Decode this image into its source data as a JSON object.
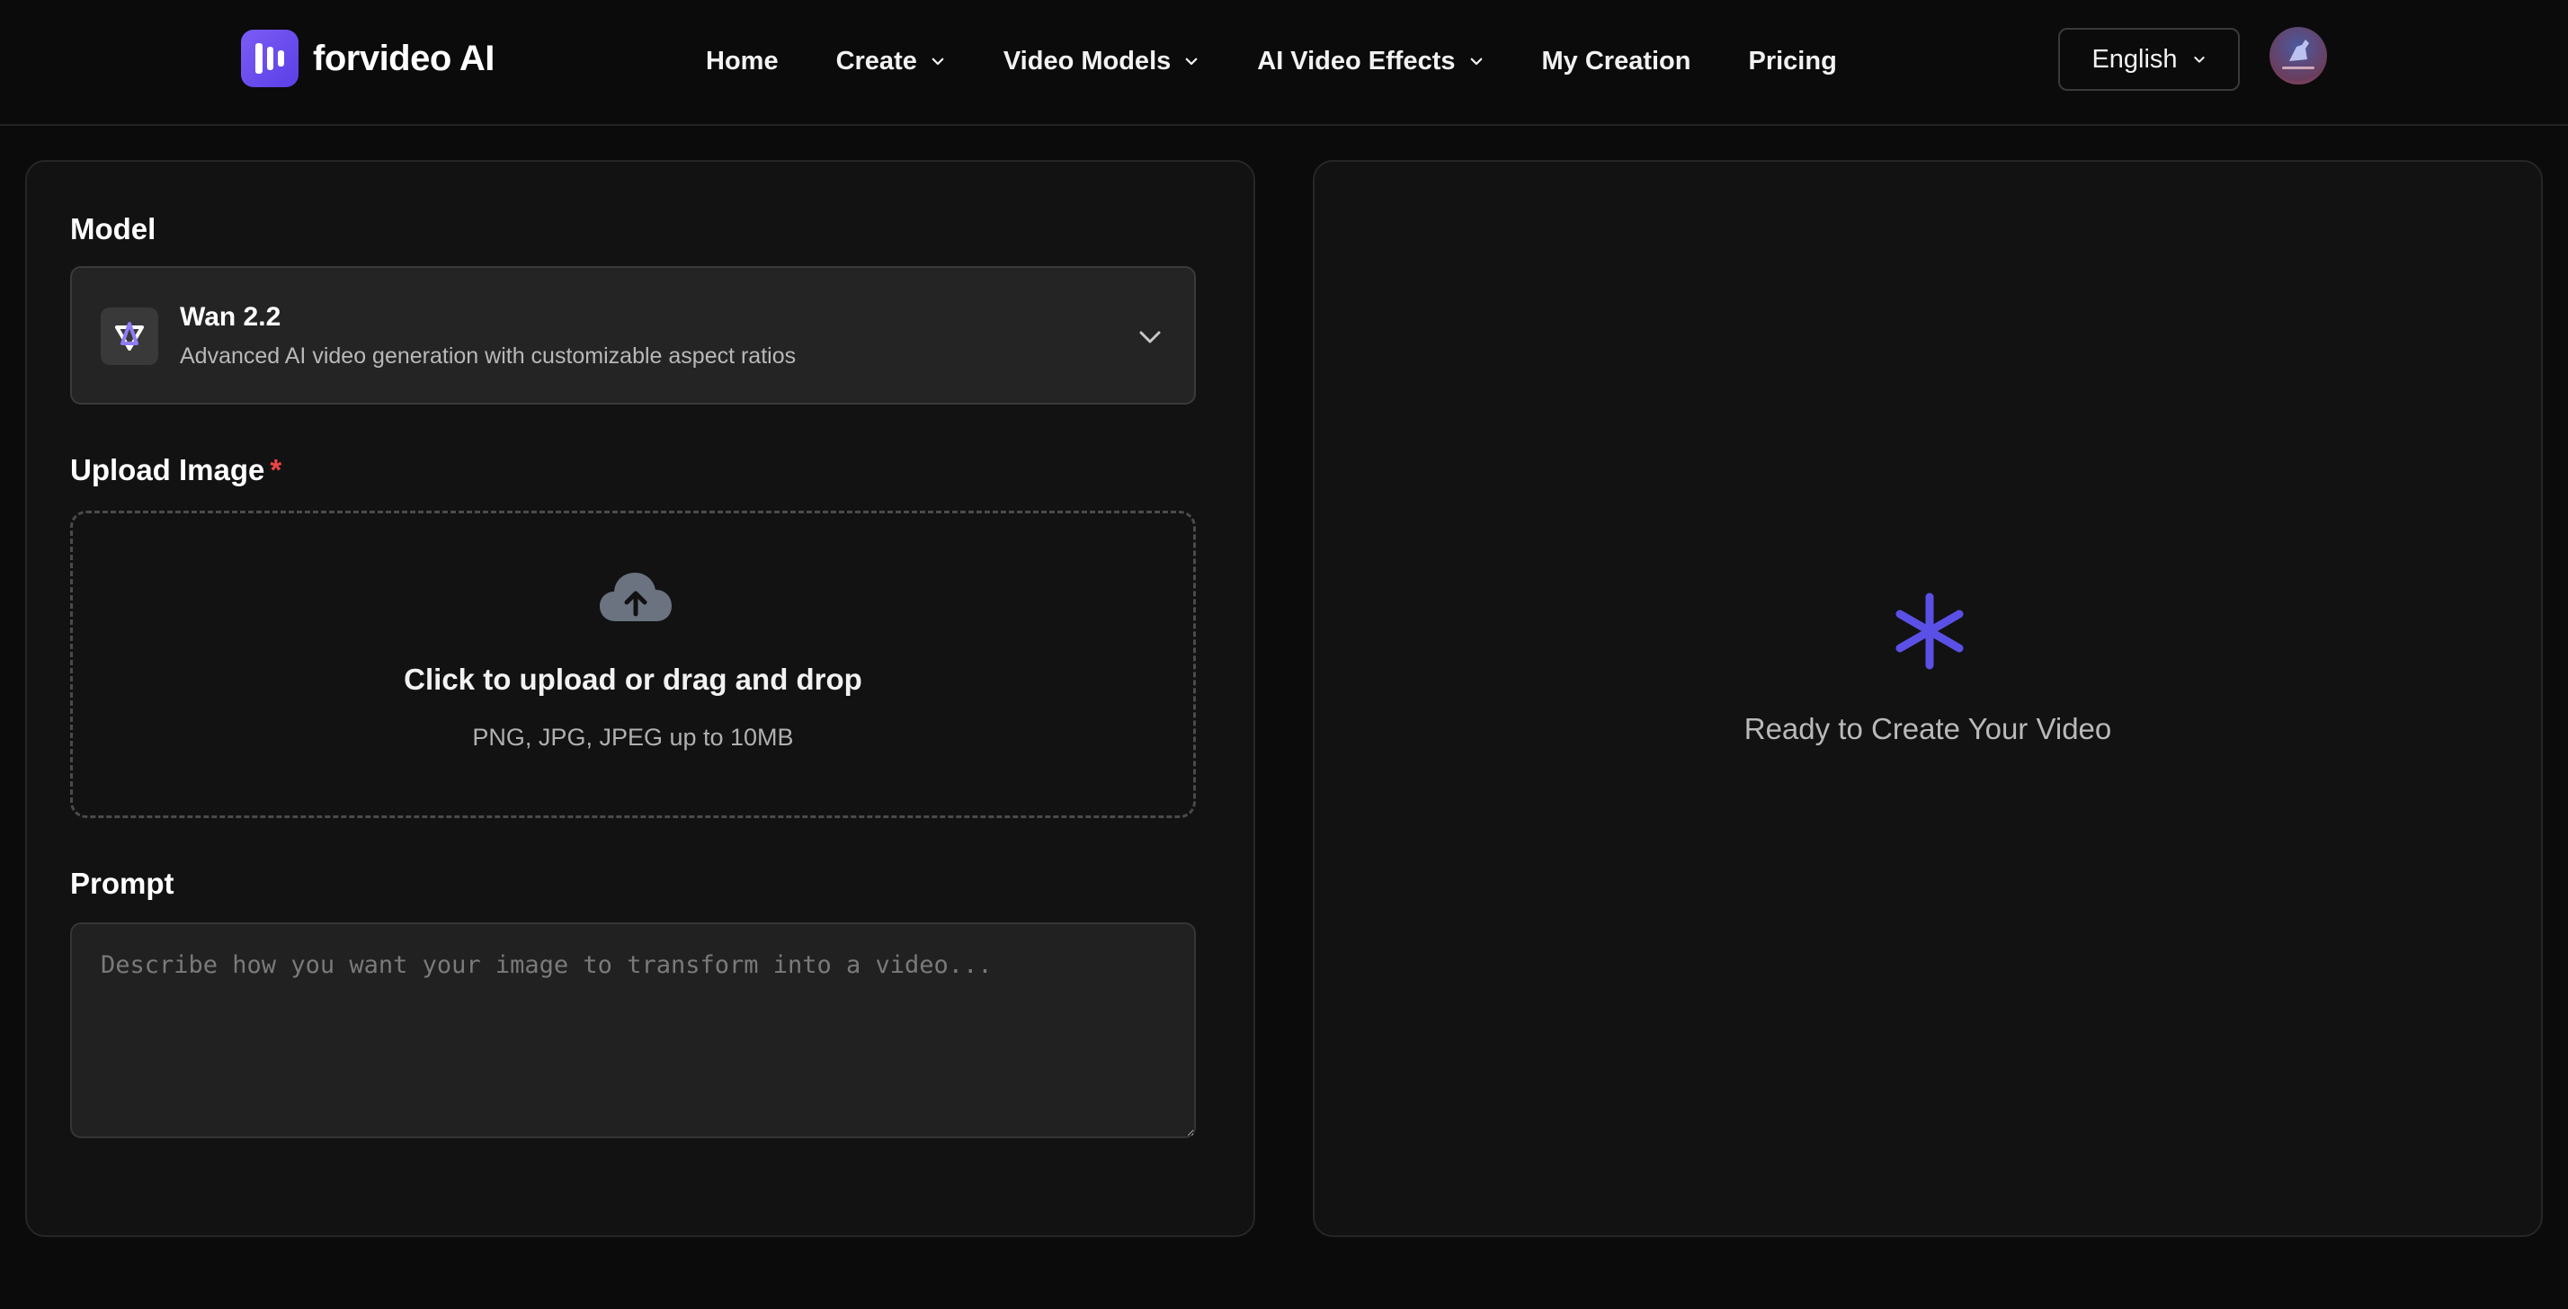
{
  "brand": {
    "name": "forvideo AI",
    "accent": "#6d4ff0"
  },
  "nav": [
    {
      "label": "Home",
      "has_dropdown": false
    },
    {
      "label": "Create",
      "has_dropdown": true
    },
    {
      "label": "Video Models",
      "has_dropdown": true
    },
    {
      "label": "AI Video Effects",
      "has_dropdown": true
    },
    {
      "label": "My Creation",
      "has_dropdown": false
    },
    {
      "label": "Pricing",
      "has_dropdown": false
    }
  ],
  "language": {
    "selected": "English"
  },
  "form": {
    "model_label": "Model",
    "model": {
      "name": "Wan 2.2",
      "description": "Advanced AI video generation with customizable aspect ratios"
    },
    "upload_label": "Upload Image",
    "required_marker": "*",
    "upload": {
      "title": "Click to upload or drag and drop",
      "hint": "PNG, JPG, JPEG up to 10MB"
    },
    "prompt_label": "Prompt",
    "prompt": {
      "value": "",
      "placeholder": "Describe how you want your image to transform into a video..."
    }
  },
  "preview": {
    "status_text": "Ready to Create Your Video",
    "icon": "asterisk-icon",
    "icon_color": "#5b50e6"
  },
  "colors": {
    "background": "#0b0b0b",
    "panel": "#121212",
    "required": "#ef4444"
  }
}
